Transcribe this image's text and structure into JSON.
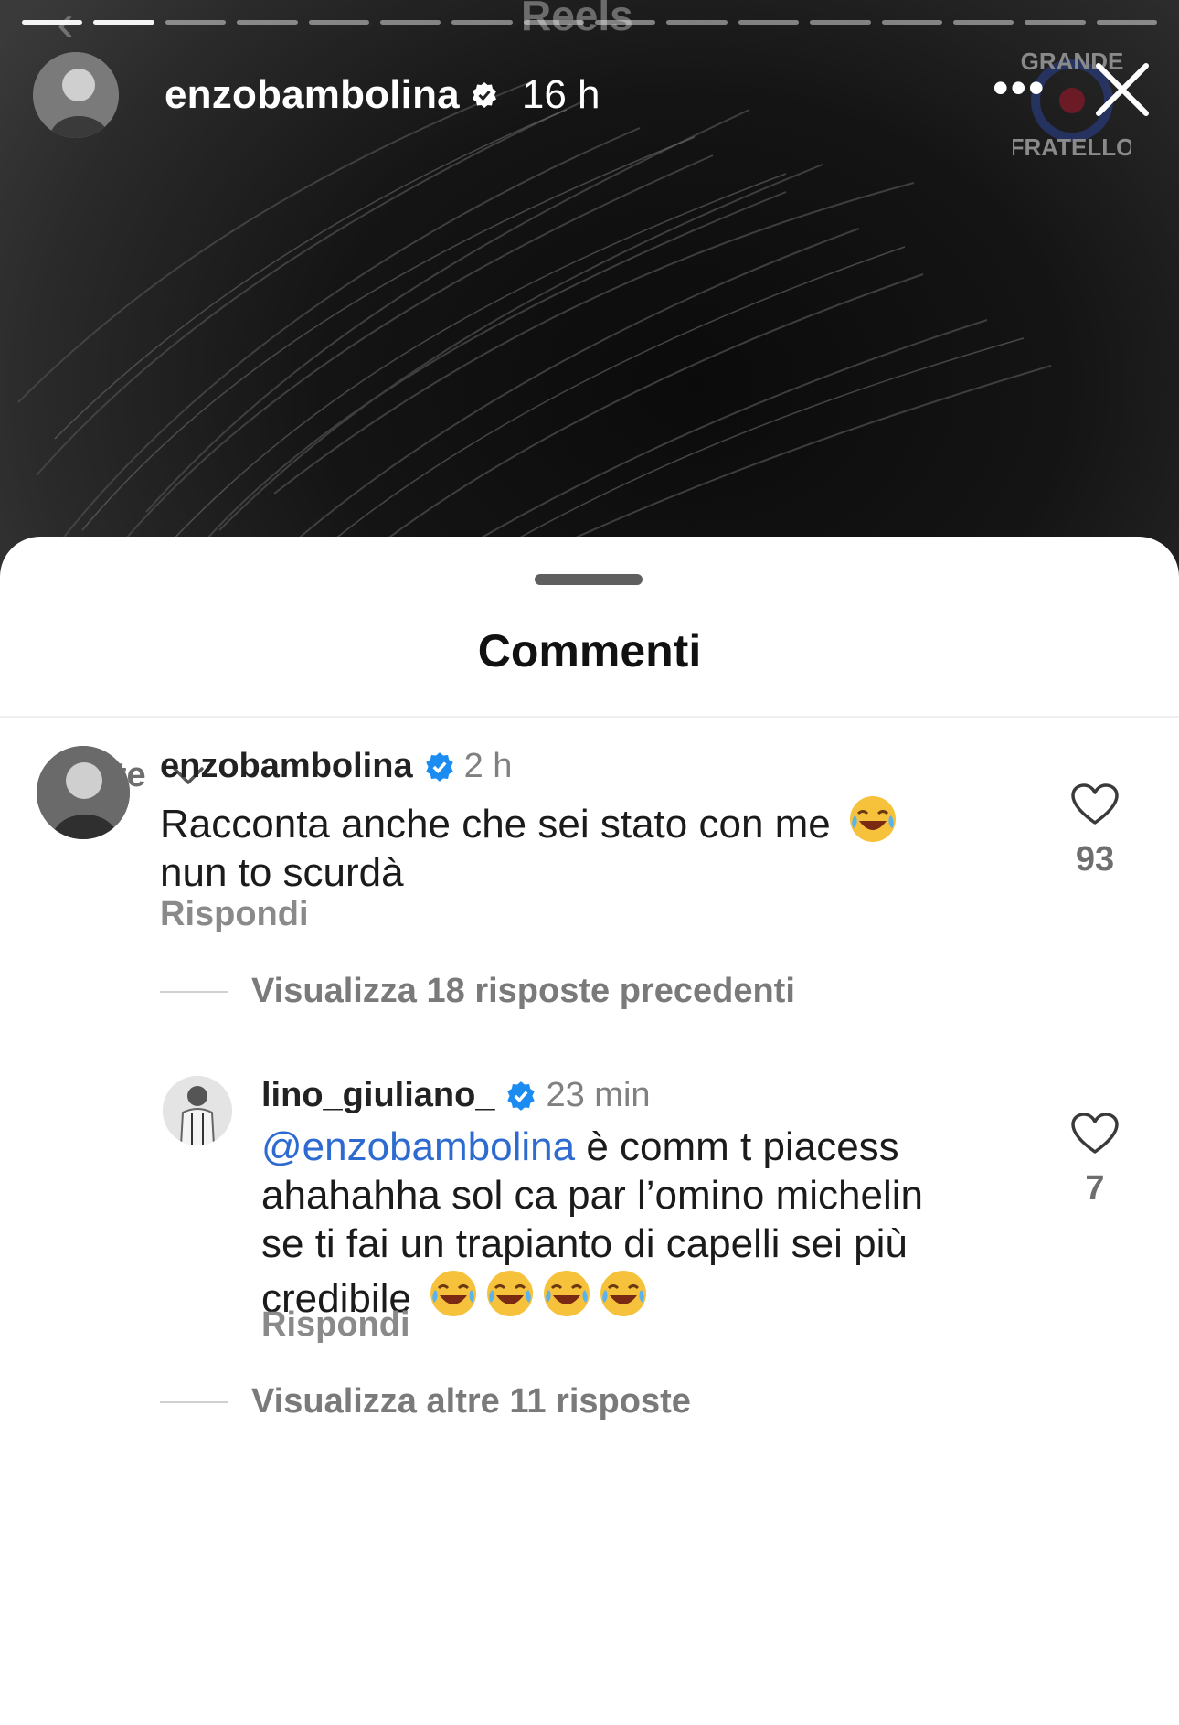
{
  "story": {
    "username": "enzobambolina",
    "time": "16 h",
    "reels_label": "Reels",
    "more_label": "•••",
    "progress_segments": 16,
    "progress_done": 2,
    "logo_text_top": "GRANDE",
    "logo_text_bottom": "FRATELLO"
  },
  "sheet": {
    "title": "Commenti",
    "sort_label": "Per te"
  },
  "comments": [
    {
      "username": "enzobambolina",
      "time": "2 h",
      "text_line1": "Racconta anche che sei stato con me",
      "text_line2": "nun to scurdà",
      "emoji": "face-with-tears-of-joy",
      "likes": "93",
      "reply_label": "Rispondi"
    }
  ],
  "thread_prev": "Visualizza 18 risposte precedenti",
  "replies": [
    {
      "username": "lino_giuliano_",
      "time": "23 min",
      "mention": "@enzobambolina",
      "text_line1": " è comm t piacess",
      "text_line2": "ahahahha sol ca par l’omino michelin",
      "text_line3": "se ti fai un trapianto di capelli sei più",
      "text_line4": "credibile",
      "emoji": "face-with-tears-of-joy",
      "emoji_count": 4,
      "likes": "7",
      "reply_label": "Rispondi"
    }
  ],
  "thread_more": "Visualizza altre 11 risposte",
  "colors": {
    "mention": "#2e6bd1",
    "verified": "#1d8cf0",
    "muted": "#8a8a8a"
  }
}
